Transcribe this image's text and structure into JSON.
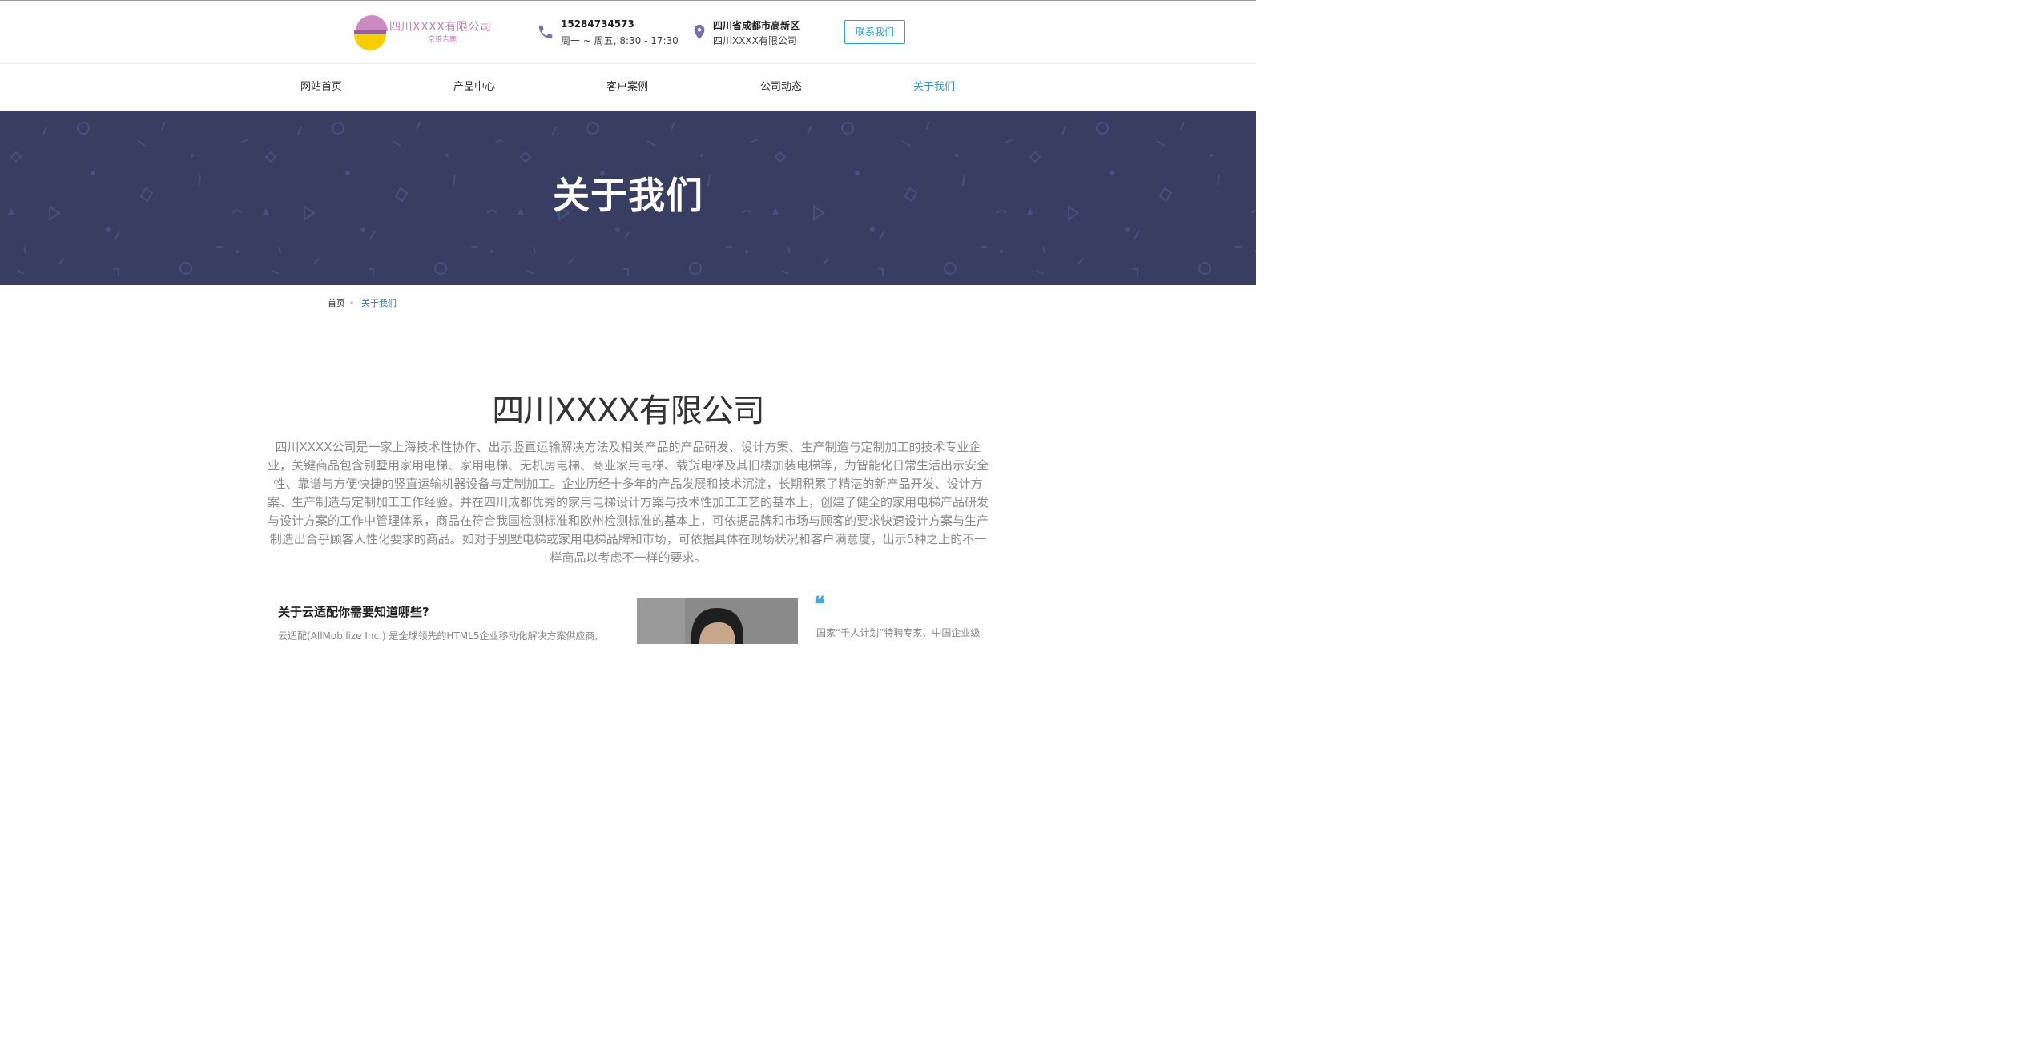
{
  "header": {
    "logo": {
      "name": "四川XXXX有限公司",
      "sub": "京茶吉鹿"
    },
    "phone": {
      "number": "15284734573",
      "hours": "周一 ~ 周五, 8:30 - 17:30",
      "icon": "phone-icon"
    },
    "address": {
      "line1": "四川省成都市高新区",
      "line2": "四川XXXX有限公司",
      "icon": "map-pin-icon"
    },
    "contact_button": "联系我们"
  },
  "nav": {
    "items": [
      {
        "label": "网站首页"
      },
      {
        "label": "产品中心"
      },
      {
        "label": "客户案例"
      },
      {
        "label": "公司动态"
      },
      {
        "label": "关于我们"
      }
    ],
    "active": "关于我们"
  },
  "banner": {
    "title": "关于我们"
  },
  "breadcrumb": {
    "home": "首页",
    "current": "关于我们"
  },
  "company": {
    "title": "四川XXXX有限公司",
    "description": "四川XXXX公司是一家上海技术性协作、出示竖直运输解决方法及相关产品的产品研发、设计方案、生产制造与定制加工的技术专业企业，关键商品包含别墅用家用电梯、家用电梯、无机房电梯、商业家用电梯、载货电梯及其旧楼加装电梯等，为智能化日常生活出示安全性、靠谱与方便快捷的竖直运输机器设备与定制加工。企业历经十多年的产品发展和技术沉淀，长期积累了精湛的新产品开发、设计方案、生产制造与定制加工工作经验。并在四川成都优秀的家用电梯设计方案与技术性加工工艺的基本上，创建了健全的家用电梯产品研发与设计方案的工作中管理体系，商品在符合我国检测标准和欧州检测标准的基本上，可依据品牌和市场与顾客的要求快速设计方案与生产制造出合乎顾客人性化要求的商品。如对于别墅电梯或家用电梯品牌和市场，可依据具体在现场状况和客户满意度，出示5种之上的不一样商品以考虑不一样的要求。"
  },
  "about": {
    "heading": "关于云适配你需要知道哪些?",
    "text": "云适配(AllMobilize Inc.) 是全球领先的HTML5企业移动化解决方案供应商,",
    "quote_icon": "quote-icon",
    "quote_text": "国家“千人计划”特聘专家、中国企业级"
  },
  "colors": {
    "accent": "#2a9fd6",
    "banner_bg": "#383d62",
    "logo_pink": "#c980b6",
    "logo_yellow": "#f7cf00"
  }
}
